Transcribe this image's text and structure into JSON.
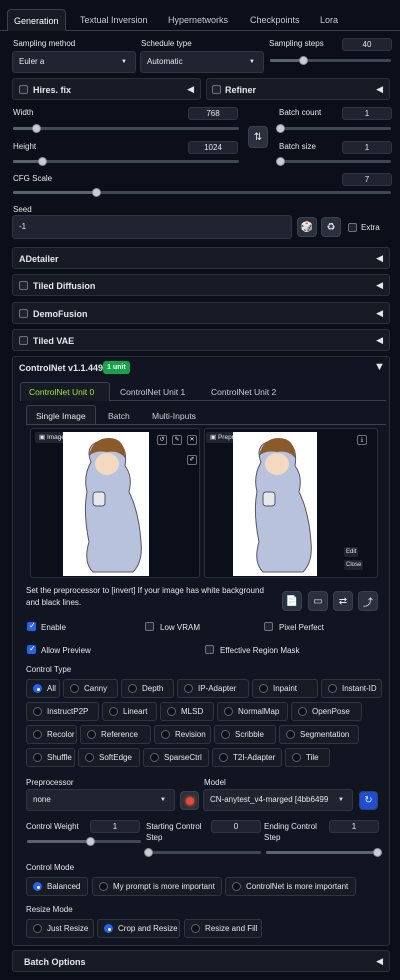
{
  "tabs": [
    "Generation",
    "Textual Inversion",
    "Hypernetworks",
    "Checkpoints",
    "Lora"
  ],
  "sampling_method": {
    "label": "Sampling method",
    "value": "Euler a"
  },
  "schedule_type": {
    "label": "Schedule type",
    "value": "Automatic"
  },
  "sampling_steps": {
    "label": "Sampling steps",
    "value": "40",
    "fraction": 0.27
  },
  "hires": {
    "label": "Hires. fix"
  },
  "refiner": {
    "label": "Refiner"
  },
  "width": {
    "label": "Width",
    "value": "768",
    "fraction": 0.1
  },
  "height": {
    "label": "Height",
    "value": "1024",
    "fraction": 0.13
  },
  "batch_count": {
    "label": "Batch count",
    "value": "1",
    "fraction": 0.0
  },
  "batch_size": {
    "label": "Batch size",
    "value": "1",
    "fraction": 0.0
  },
  "cfg": {
    "label": "CFG Scale",
    "value": "7",
    "fraction": 0.22
  },
  "seed": {
    "label": "Seed",
    "value": "-1",
    "extra": "Extra"
  },
  "accordions": [
    "ADetailer",
    "Tiled Diffusion",
    "DemoFusion",
    "Tiled VAE"
  ],
  "controlnet": {
    "title": "ControlNet v1.1.449",
    "badge": "1 unit",
    "units": [
      "ControlNet Unit 0",
      "ControlNet Unit 1",
      "ControlNet Unit 2"
    ],
    "subtabs": [
      "Single Image",
      "Batch",
      "Multi-Inputs"
    ],
    "image_label": "Image",
    "preview_label": "Preprocessor Preview",
    "edit": "Edit",
    "close": "Close",
    "hint": "Set the preprocessor to [invert] If your image has white background and black lines.",
    "enable": "Enable",
    "low_vram": "Low VRAM",
    "pixel_perfect": "Pixel Perfect",
    "allow_preview": "Allow Preview",
    "effective_mask": "Effective Region Mask",
    "control_type_label": "Control Type",
    "control_types": [
      [
        "All",
        "Canny",
        "Depth",
        "IP-Adapter",
        "Inpaint",
        "Instant-ID"
      ],
      [
        "InstructP2P",
        "Lineart",
        "MLSD",
        "NormalMap",
        "OpenPose"
      ],
      [
        "Recolor",
        "Reference",
        "Revision",
        "Scribble",
        "Segmentation"
      ],
      [
        "Shuffle",
        "SoftEdge",
        "SparseCtrl",
        "T2I-Adapter",
        "Tile"
      ]
    ],
    "preprocessor": {
      "label": "Preprocessor",
      "value": "none"
    },
    "model": {
      "label": "Model",
      "value": "CN-anytest_v4-marged [4bb6499"
    },
    "weight": {
      "label": "Control Weight",
      "value": "1",
      "fraction": 0.55
    },
    "start": {
      "label": "Starting Control Step",
      "value": "0",
      "fraction": 0.0
    },
    "end": {
      "label": "Ending Control Step",
      "value": "1",
      "fraction": 1.0
    },
    "mode_label": "Control Mode",
    "modes": [
      "Balanced",
      "My prompt is more important",
      "ControlNet is more important"
    ],
    "resize_label": "Resize Mode",
    "resizes": [
      "Just Resize",
      "Crop and Resize",
      "Resize and Fill"
    ]
  },
  "batch_options": "Batch Options"
}
